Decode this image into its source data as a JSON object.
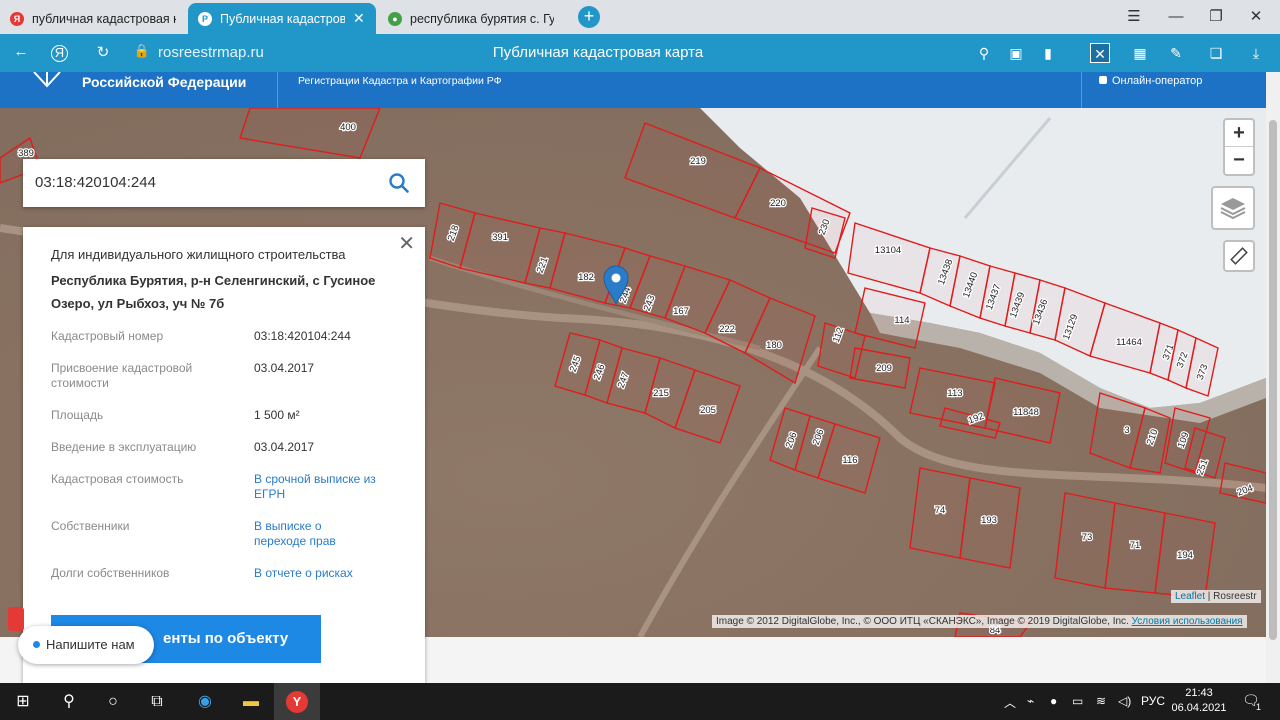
{
  "browser": {
    "tabs": [
      {
        "label": "публичная кадастровая к",
        "active": false,
        "favicon": "yandex-icon",
        "color": "#e53935"
      },
      {
        "label": "Публичная кадастровая",
        "active": true,
        "favicon": "rosreestr-icon",
        "color": "#2196c9"
      },
      {
        "label": "республика бурятия с. Гус",
        "active": false,
        "favicon": "map-pin-green-icon",
        "color": "#43a047"
      }
    ],
    "url": "rosreestrmap.ru",
    "page_title": "Публичная кадастровая карта",
    "accent": "#2196c9"
  },
  "site_header": {
    "org": "Российской Федерации",
    "dept": "Регистрации Кадастра и Картографии РФ",
    "chat": "Онлайн-оператор"
  },
  "search": {
    "query": "03:18:420104:244"
  },
  "info": {
    "purpose": "Для индивидуального жилищного строительства",
    "address": "Республика Бурятия, р-н Селенгинский, с Гусиное Озеро, ул Рыбхоз, уч № 7б",
    "rows": [
      {
        "label": "Кадастровый номер",
        "value": "03:18:420104:244",
        "link": false
      },
      {
        "label": "Присвоение кадастровой стоимости",
        "value": "03.04.2017",
        "link": false
      },
      {
        "label": "Площадь",
        "value": "1 500 м²",
        "link": false
      },
      {
        "label": "Введение в эксплуатацию",
        "value": "03.04.2017",
        "link": false
      },
      {
        "label": "Кадастровая стоимость",
        "value": "В срочной выписке из ЕГРН",
        "link": true
      },
      {
        "label": "Собственники",
        "value": "В выписке о переходе прав",
        "link": true
      },
      {
        "label": "Долги собственников",
        "value": "В отчете о рисках",
        "link": true
      }
    ],
    "doc_button": "енты по объекту",
    "write_us": "Напишите нам"
  },
  "map": {
    "zoom_in": "+",
    "zoom_out": "−",
    "attribution_leaflet": "Leaflet",
    "attribution_sep": " | Rosreestr",
    "imagery": "Image © 2012 DigitalGlobe, Inc., © ООО ИТЦ «СКАНЭКС», Image © 2019 DigitalGlobe, Inc.",
    "terms": "Условия использования",
    "parcel_color": "#e01c1c",
    "parcels": [
      "389",
      "400",
      "219",
      "220",
      "218",
      "391",
      "221",
      "182",
      "244",
      "243",
      "167",
      "222",
      "180",
      "230",
      "13104",
      "13438",
      "13440",
      "13437",
      "13439",
      "13436",
      "13129",
      "11464",
      "371",
      "372",
      "373",
      "114",
      "112",
      "209",
      "113",
      "192",
      "11848",
      "3",
      "210",
      "109",
      "251",
      "245",
      "246",
      "247",
      "215",
      "205",
      "206",
      "206",
      "116",
      "74",
      "193",
      "73",
      "71",
      "194",
      "204",
      "84"
    ]
  },
  "taskbar": {
    "lang": "РУС",
    "time": "21:43",
    "date": "06.04.2021",
    "notifications": "1"
  }
}
